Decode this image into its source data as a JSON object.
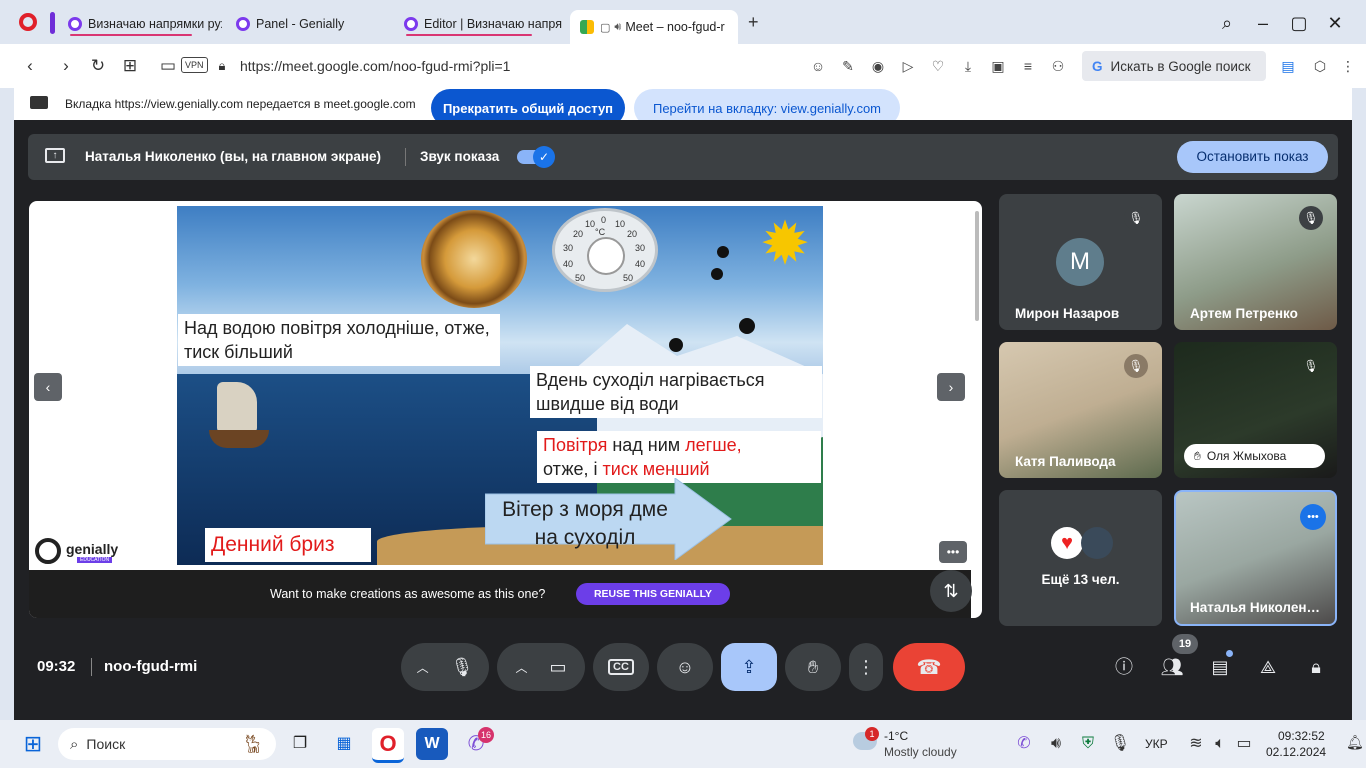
{
  "browser": {
    "tabs": [
      {
        "title": "Визначаю напрямки рух"
      },
      {
        "title": "Panel - Genially"
      },
      {
        "title": "Editor | Визначаю напрям"
      },
      {
        "title": "Meet – noo-fgud-r"
      }
    ],
    "new_tab_label": "+",
    "vpn_badge": "VPN",
    "url": "https://meet.google.com/noo-fgud-rmi?pli=1",
    "search_label": "Искать в Google поиск"
  },
  "sharing_bar": {
    "message": "Вкладка https://view.genially.com передается в meet.google.com",
    "stop_button": "Прекратить общий доступ",
    "goto_button": "Перейти на вкладку: view.genially.com"
  },
  "meet": {
    "presenter_text": "Наталья Николенко (вы, на главном экране)",
    "show_sound_label": "Звук показа",
    "stop_show_button": "Остановить показ",
    "slide": {
      "text1": "Над водою повітря холодніше, отже, тиск більший",
      "text2": "Вдень суходіл нагрівається швидше від води",
      "text3_a": "Повітря",
      "text3_b": " над ним ",
      "text3_c": "легше,",
      "text3_d": "отже, і ",
      "text3_e": "тиск менший",
      "arrow_text": "Вітер з моря дме на суходіл",
      "title": "Денний бриз",
      "thermo_labels": [
        "20",
        "10",
        "0",
        "10",
        "20",
        "30",
        "30",
        "40",
        "40",
        "50",
        "50",
        "°C"
      ],
      "genially_logo": "genially",
      "genially_sub": "EDUCATION"
    },
    "banner_text": "Want to make creations as awesome as this one?",
    "reuse_button": "REUSE THIS GENIALLY",
    "participants": [
      {
        "name": "Мирон Назаров",
        "avatar_letter": "M"
      },
      {
        "name": "Артем Петренко"
      },
      {
        "name": "Катя Паливода"
      },
      {
        "name": "Оля Жмыхова"
      },
      {
        "name": "Ещё 13 чел."
      },
      {
        "name": "Наталья Николен…"
      }
    ],
    "time": "09:32",
    "meeting_code": "noo-fgud-rmi",
    "participant_count": "19",
    "accent_red": "#ea4335",
    "accent_blue": "#a8c7fa"
  },
  "taskbar": {
    "search_placeholder": "Поиск",
    "weather_badge": "1",
    "weather_temp": "-1°C",
    "weather_desc": "Mostly cloudy",
    "viber_badge": "16",
    "lang": "УКР",
    "clock_time": "09:32:52",
    "clock_date": "02.12.2024"
  }
}
